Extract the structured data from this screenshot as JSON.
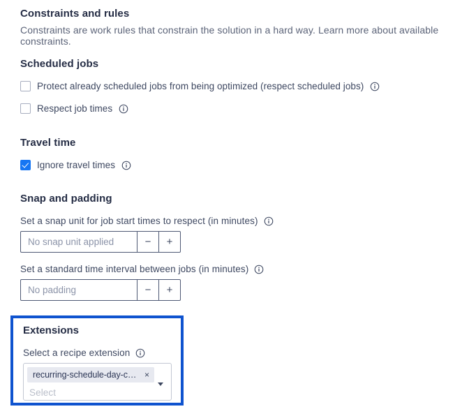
{
  "header": {
    "title": "Constraints and rules",
    "description": "Constraints are work rules that constrain the solution in a hard way. Learn more about available constraints."
  },
  "scheduled_jobs": {
    "title": "Scheduled jobs",
    "options": [
      {
        "label": "Protect already scheduled jobs from being optimized (respect scheduled jobs)",
        "checked": false,
        "info_icon": "info-icon"
      },
      {
        "label": "Respect job times",
        "checked": false,
        "info_icon": "info-icon"
      }
    ]
  },
  "travel_time": {
    "title": "Travel time",
    "options": [
      {
        "label": "Ignore travel times",
        "checked": true,
        "info_icon": "info-icon"
      }
    ]
  },
  "snap_and_padding": {
    "title": "Snap and padding",
    "fields": [
      {
        "label": "Set a snap unit for job start times to respect (in minutes)",
        "placeholder": "No snap unit applied",
        "value": "",
        "decrement_label": "−",
        "increment_label": "+",
        "info_icon": "info-icon"
      },
      {
        "label": "Set a standard time interval between jobs (in minutes)",
        "placeholder": "No padding",
        "value": "",
        "decrement_label": "−",
        "increment_label": "+",
        "info_icon": "info-icon"
      }
    ]
  },
  "extensions": {
    "title": "Extensions",
    "field_label": "Select a recipe extension",
    "info_icon": "info-icon",
    "selected_chips": [
      {
        "label": "recurring-schedule-day-con…",
        "remove_label": "×"
      }
    ],
    "placeholder": "Select",
    "caret_icon": "chevron-down-icon",
    "highlight_color": "#0f53cf"
  },
  "colors": {
    "accent_blue": "#1676f3",
    "highlight_border": "#0f53cf",
    "heading": "#242c44",
    "body_text": "#5b6378",
    "chip_bg": "#e7e9f0"
  }
}
